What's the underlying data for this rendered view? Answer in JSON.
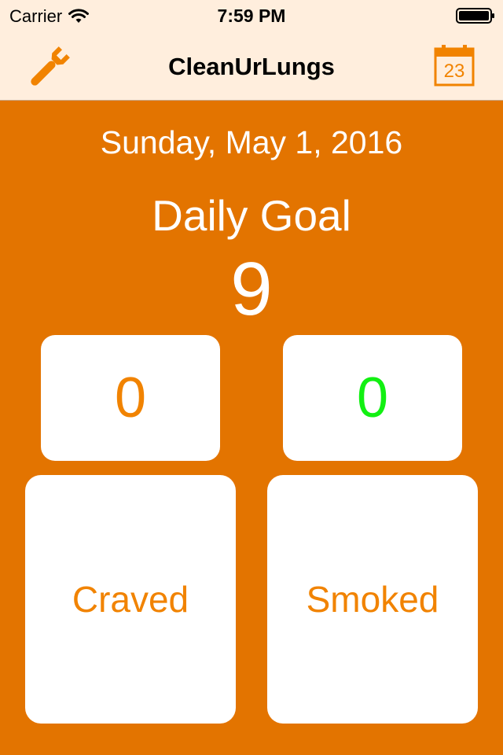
{
  "status_bar": {
    "carrier": "Carrier",
    "time": "7:59 PM"
  },
  "nav": {
    "title": "CleanUrLungs",
    "calendar_day": "23",
    "left_icon": "wrench-icon",
    "right_icon": "calendar-icon",
    "accent_color": "#F18300"
  },
  "main": {
    "date": "Sunday, May 1, 2016",
    "goal_label": "Daily Goal",
    "goal_value": "9",
    "craved_count": "0",
    "smoked_count": "0",
    "craved_label": "Craved",
    "smoked_label": "Smoked",
    "background_color": "#E37400",
    "smoked_count_color": "#12F012"
  }
}
